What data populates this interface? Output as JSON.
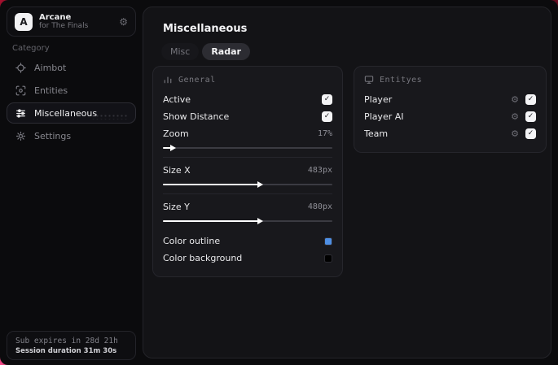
{
  "app": {
    "name": "Arcane",
    "subtitle": "for The Finals",
    "avatar_letter": "A"
  },
  "icons": {
    "check_glyph": "✓",
    "gear_glyph": "⚙"
  },
  "colors": {
    "accent_red": "#a8102f",
    "accent_pink": "#ff4d8d",
    "outline_blue": "#4e8fe4",
    "background_black": "#000000"
  },
  "sidebar": {
    "category_label": "Category",
    "items": [
      {
        "label": "Aimbot",
        "icon": "crosshair-icon",
        "selected": false
      },
      {
        "label": "Entities",
        "icon": "scan-icon",
        "selected": false
      },
      {
        "label": "Miscellaneous",
        "icon": "sliders-icon",
        "selected": true
      },
      {
        "label": "Settings",
        "icon": "gear-icon",
        "selected": false
      }
    ],
    "footer": {
      "line1": "Sub expires in 28d 21h",
      "line2": "Session duration 31m 30s"
    }
  },
  "main": {
    "title": "Miscellaneous",
    "tabs": [
      {
        "label": "Misc",
        "active": false
      },
      {
        "label": "Radar",
        "active": true
      }
    ],
    "general_panel": {
      "header": "General",
      "active": {
        "label": "Active",
        "checked": true
      },
      "show_distance": {
        "label": "Show Distance",
        "checked": true
      },
      "zoom": {
        "label": "Zoom",
        "value": "17%",
        "percent": 6
      },
      "size_x": {
        "label": "Size X",
        "value": "483px",
        "percent": 57
      },
      "size_y": {
        "label": "Size Y",
        "value": "480px",
        "percent": 57
      },
      "color_outline": {
        "label": "Color outline",
        "color": "#4e8fe4"
      },
      "color_background": {
        "label": "Color background",
        "color": "#000000"
      }
    },
    "entities_panel": {
      "header": "Entityes",
      "rows": [
        {
          "label": "Player",
          "checked": true
        },
        {
          "label": "Player AI",
          "checked": true
        },
        {
          "label": "Team",
          "checked": true
        }
      ]
    }
  }
}
